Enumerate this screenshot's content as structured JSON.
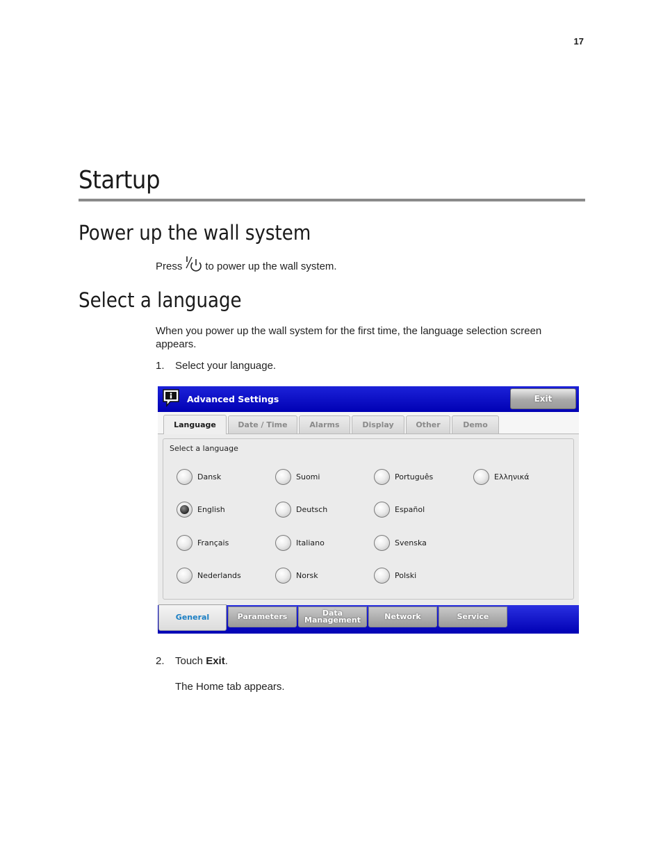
{
  "page_number": "17",
  "heading": "Startup",
  "sections": [
    {
      "title": "Power up the wall system",
      "text_before": "Press",
      "icon": "power-icon",
      "text_after": "to power up the wall system."
    },
    {
      "title": "Select a language",
      "intro": "When you power up the wall system for the first time, the language selection screen appears."
    }
  ],
  "steps": [
    {
      "number": "1.",
      "text": "Select your language."
    },
    {
      "number": "2.",
      "text_before": "Touch",
      "bold": "Exit",
      "text_after": ".",
      "result": "The Home tab appears."
    }
  ],
  "screenshot": {
    "title_icon": "info-icon",
    "title": "Advanced Settings",
    "exit_label": "Exit",
    "tabs": [
      "Language",
      "Date / Time",
      "Alarms",
      "Display",
      "Other",
      "Demo"
    ],
    "active_tab": "Language",
    "panel_label": "Select a language",
    "languages": [
      [
        "Dansk",
        "Suomi",
        "Português",
        "Ελληνικά"
      ],
      [
        "English",
        "Deutsch",
        "Español"
      ],
      [
        "Français",
        "Italiano",
        "Svenska"
      ],
      [
        "Nederlands",
        "Norsk",
        "Polski"
      ]
    ],
    "selected_language": "English",
    "bottom_tabs": [
      "General",
      "Parameters",
      "Data Management",
      "Network",
      "Service"
    ],
    "active_bottom_tab": "General",
    "colors": {
      "title_bar": "#0000b4",
      "active_bottom_tab_text": "#1b7fc4"
    }
  }
}
